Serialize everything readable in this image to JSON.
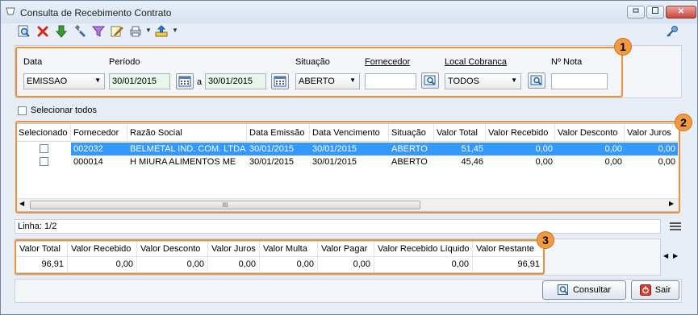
{
  "window": {
    "title": "Consulta de Recebimento Contrato"
  },
  "toolbar": {
    "icons": [
      "search-doc-icon",
      "delete-icon",
      "download-icon",
      "tools-icon",
      "filter-icon",
      "edit-icon",
      "print-icon",
      "export-icon"
    ]
  },
  "filters": {
    "data_label": "Data",
    "data_value": "EMISSAO",
    "periodo_label": "Período",
    "date_from": "30/01/2015",
    "date_sep": "a",
    "date_to": "30/01/2015",
    "situacao_label": "Situação",
    "situacao_value": "ABERTO",
    "fornecedor_label": "Fornecedor",
    "fornecedor_value": "",
    "local_cobranca_label": "Local Cobranca",
    "local_cobranca_value": "TODOS",
    "nota_label": "Nº Nota",
    "nota_value": ""
  },
  "select_all_label": "Selecionar todos",
  "grid": {
    "columns": [
      "Selecionado",
      "Fornecedor",
      "Razão Social",
      "Data Emissão",
      "Data Vencimento",
      "Situação",
      "Valor Total",
      "Valor Recebido",
      "Valor Desconto",
      "Valor Juros"
    ],
    "rows": [
      {
        "fornecedor": "002032",
        "razao": "BELMETAL IND. COM. LTDA",
        "emissao": "30/01/2015",
        "vencimento": "30/01/2015",
        "situacao": "ABERTO",
        "total": "51,45",
        "recebido": "0,00",
        "desconto": "0,00",
        "juros": "0,00",
        "selected": true
      },
      {
        "fornecedor": "000014",
        "razao": "H MIURA ALIMENTOS ME",
        "emissao": "30/01/2015",
        "vencimento": "30/01/2015",
        "situacao": "ABERTO",
        "total": "45,46",
        "recebido": "0,00",
        "desconto": "0,00",
        "juros": "0,00",
        "selected": false
      }
    ],
    "scroll_grip": "III"
  },
  "status": {
    "linha": "Linha: 1/2"
  },
  "totals": {
    "headers": [
      "Valor Total",
      "Valor Recebido",
      "Valor Desconto",
      "Valor Juros",
      "Valor Multa",
      "Valor Pagar",
      "Valor Recebido Líquido",
      "Valor Restante"
    ],
    "values": [
      "96,91",
      "0,00",
      "0,00",
      "0,00",
      "0,00",
      "0,00",
      "0,00",
      "96,91"
    ]
  },
  "callouts": [
    "1",
    "2",
    "3"
  ],
  "buttons": {
    "consultar": "Consultar",
    "sair": "Sair"
  },
  "colors": {
    "callout": "#f0903a",
    "selection": "#3399ff",
    "date_field": "#e6f7ea"
  }
}
